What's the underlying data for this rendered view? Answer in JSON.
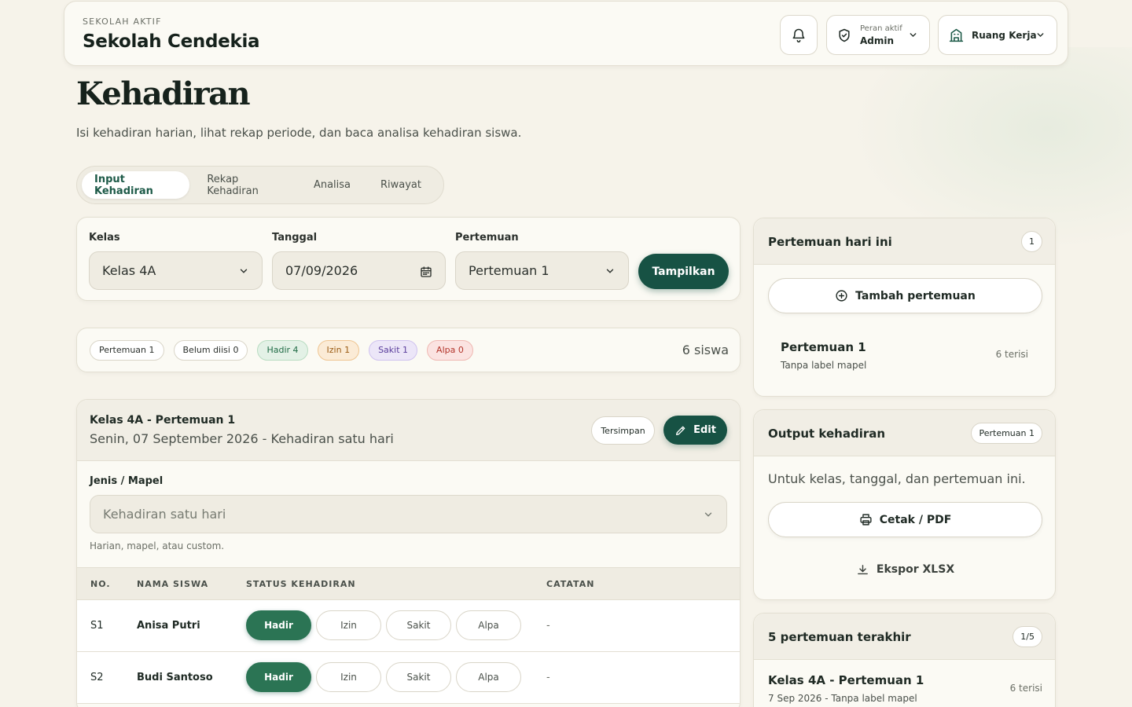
{
  "topbar": {
    "eyebrow": "SEKOLAH AKTIF",
    "school_name": "Sekolah Cendekia",
    "role_small": "Peran aktif",
    "role_value": "Admin",
    "workspace_label": "Ruang Kerja"
  },
  "page": {
    "title": "Kehadiran",
    "subtitle": "Isi kehadiran harian, lihat rekap periode, dan baca analisa kehadiran siswa."
  },
  "tabs": [
    "Input Kehadiran",
    "Rekap Kehadiran",
    "Analisa",
    "Riwayat"
  ],
  "filters": {
    "kelas_label": "Kelas",
    "kelas_value": "Kelas 4A",
    "tanggal_label": "Tanggal",
    "tanggal_value": "07/09/2026",
    "pertemuan_label": "Pertemuan",
    "pertemuan_value": "Pertemuan 1",
    "submit_label": "Tampilkan"
  },
  "summary": {
    "pills": [
      "Pertemuan 1",
      "Belum diisi 0",
      "Hadir 4",
      "Izin 1",
      "Sakit 1",
      "Alpa 0"
    ],
    "count": "6 siswa"
  },
  "session": {
    "title": "Kelas 4A - Pertemuan 1",
    "subtitle": "Senin, 07 September 2026 - Kehadiran satu hari",
    "saved_label": "Tersimpan",
    "edit_label": "Edit",
    "jenis_label": "Jenis / Mapel",
    "jenis_value": "Kehadiran satu hari",
    "jenis_help": "Harian, mapel, atau custom.",
    "columns": [
      "NO.",
      "NAMA SISWA",
      "STATUS KEHADIRAN",
      "CATATAN"
    ],
    "status_options": [
      "Hadir",
      "Izin",
      "Sakit",
      "Alpa"
    ],
    "rows": [
      {
        "no": "S1",
        "name": "Anisa Putri",
        "status": "Hadir",
        "note": "-"
      },
      {
        "no": "S2",
        "name": "Budi Santoso",
        "status": "Hadir",
        "note": "-"
      }
    ]
  },
  "today": {
    "title": "Pertemuan hari ini",
    "badge": "1",
    "add_label": "Tambah pertemuan",
    "item_title": "Pertemuan 1",
    "item_sub": "Tanpa label mapel",
    "item_count": "6 terisi"
  },
  "output": {
    "title": "Output kehadiran",
    "badge": "Pertemuan 1",
    "desc": "Untuk kelas, tanggal, dan pertemuan ini.",
    "print_label": "Cetak / PDF",
    "export_label": "Ekspor XLSX"
  },
  "recent": {
    "title": "5 pertemuan terakhir",
    "badge": "1/5",
    "item_title": "Kelas 4A - Pertemuan 1",
    "item_sub": "7 Sep 2026 - Tanpa label mapel",
    "item_count": "6 terisi"
  }
}
